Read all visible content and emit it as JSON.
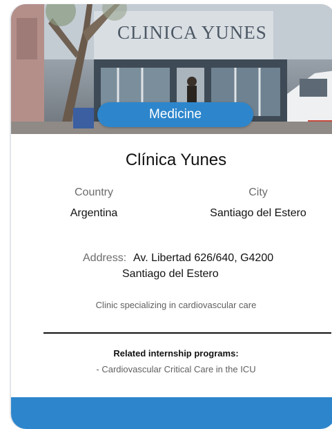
{
  "card": {
    "image": {
      "description_icon": "building-photo",
      "sign_text": "CLINICA YUNES"
    },
    "category_badge": "Medicine",
    "title": "Clínica Yunes",
    "country_label": "Country",
    "country_value": "Argentina",
    "city_label": "City",
    "city_value": "Santiago del Estero",
    "address_label": "Address:",
    "address_line1": "Av. Libertad 626/640, G4200",
    "address_line2": "Santiago del Estero",
    "description": "Clinic specializing in cardiovascular care",
    "related_heading": "Related internship programs:",
    "related_programs": [
      "- Cardiovascular Critical Care in the ICU"
    ]
  },
  "colors": {
    "accent": "#2d86cc",
    "text_primary": "#111111",
    "text_secondary": "#6b6b6b"
  }
}
